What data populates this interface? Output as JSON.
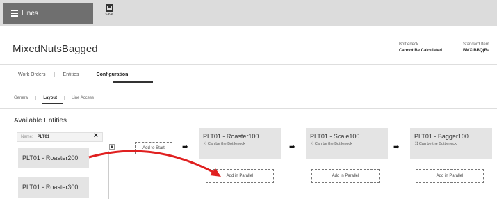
{
  "topbar": {
    "lines_label": "Lines",
    "save_label": "Save"
  },
  "header": {
    "title": "MixedNutsBagged",
    "bottleneck_label": "Bottleneck",
    "bottleneck_value": "Cannot Be Calculated",
    "standard_item_label": "Standard Item",
    "standard_item_value": "BMX-BBQ(Ba"
  },
  "tabs": [
    "Work Orders",
    "Entities",
    "Configuration"
  ],
  "subtabs": [
    "General",
    "Layout",
    "Line Access"
  ],
  "available": {
    "title": "Available Entities",
    "search_placeholder": "Name:",
    "search_value": "PLT01",
    "items": [
      "PLT01 - Roaster200",
      "PLT01 - Roaster300"
    ]
  },
  "flow": {
    "add_start": "Add to Start",
    "stations": [
      {
        "name": "PLT01 - Roaster100",
        "bottleneck": "Can be the Bottleneck",
        "parallel": "Add in Parallel"
      },
      {
        "name": "PLT01 - Scale100",
        "bottleneck": "Can be the Bottleneck",
        "parallel": "Add in Parallel"
      },
      {
        "name": "PLT01 - Bagger100",
        "bottleneck": "Can be the Bottleneck",
        "parallel": "Add in Parallel"
      }
    ]
  },
  "colors": {
    "drag_arrow": "#e02020",
    "topbar": "#dcdcdc",
    "button": "#6f6f6f"
  }
}
